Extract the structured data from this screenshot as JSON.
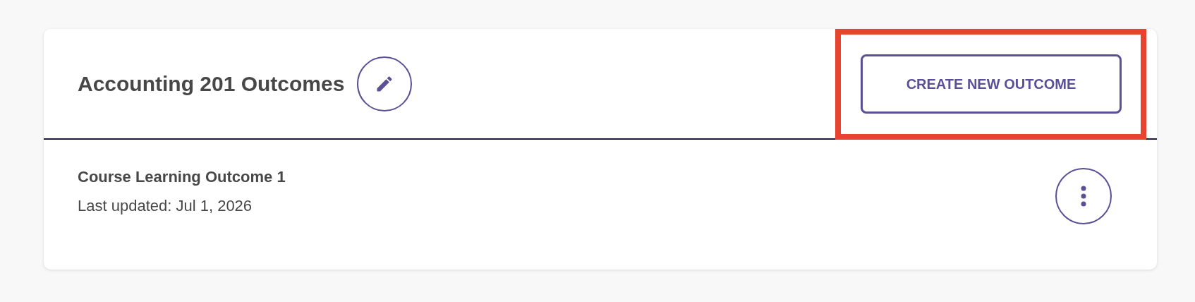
{
  "header": {
    "title": "Accounting 201 Outcomes",
    "create_button": {
      "label": "CREATE NEW OUTCOME",
      "highlighted": true
    }
  },
  "outcomes": [
    {
      "title": "Course Learning Outcome 1",
      "updated": "Last updated: Jul 1, 2026"
    }
  ]
}
